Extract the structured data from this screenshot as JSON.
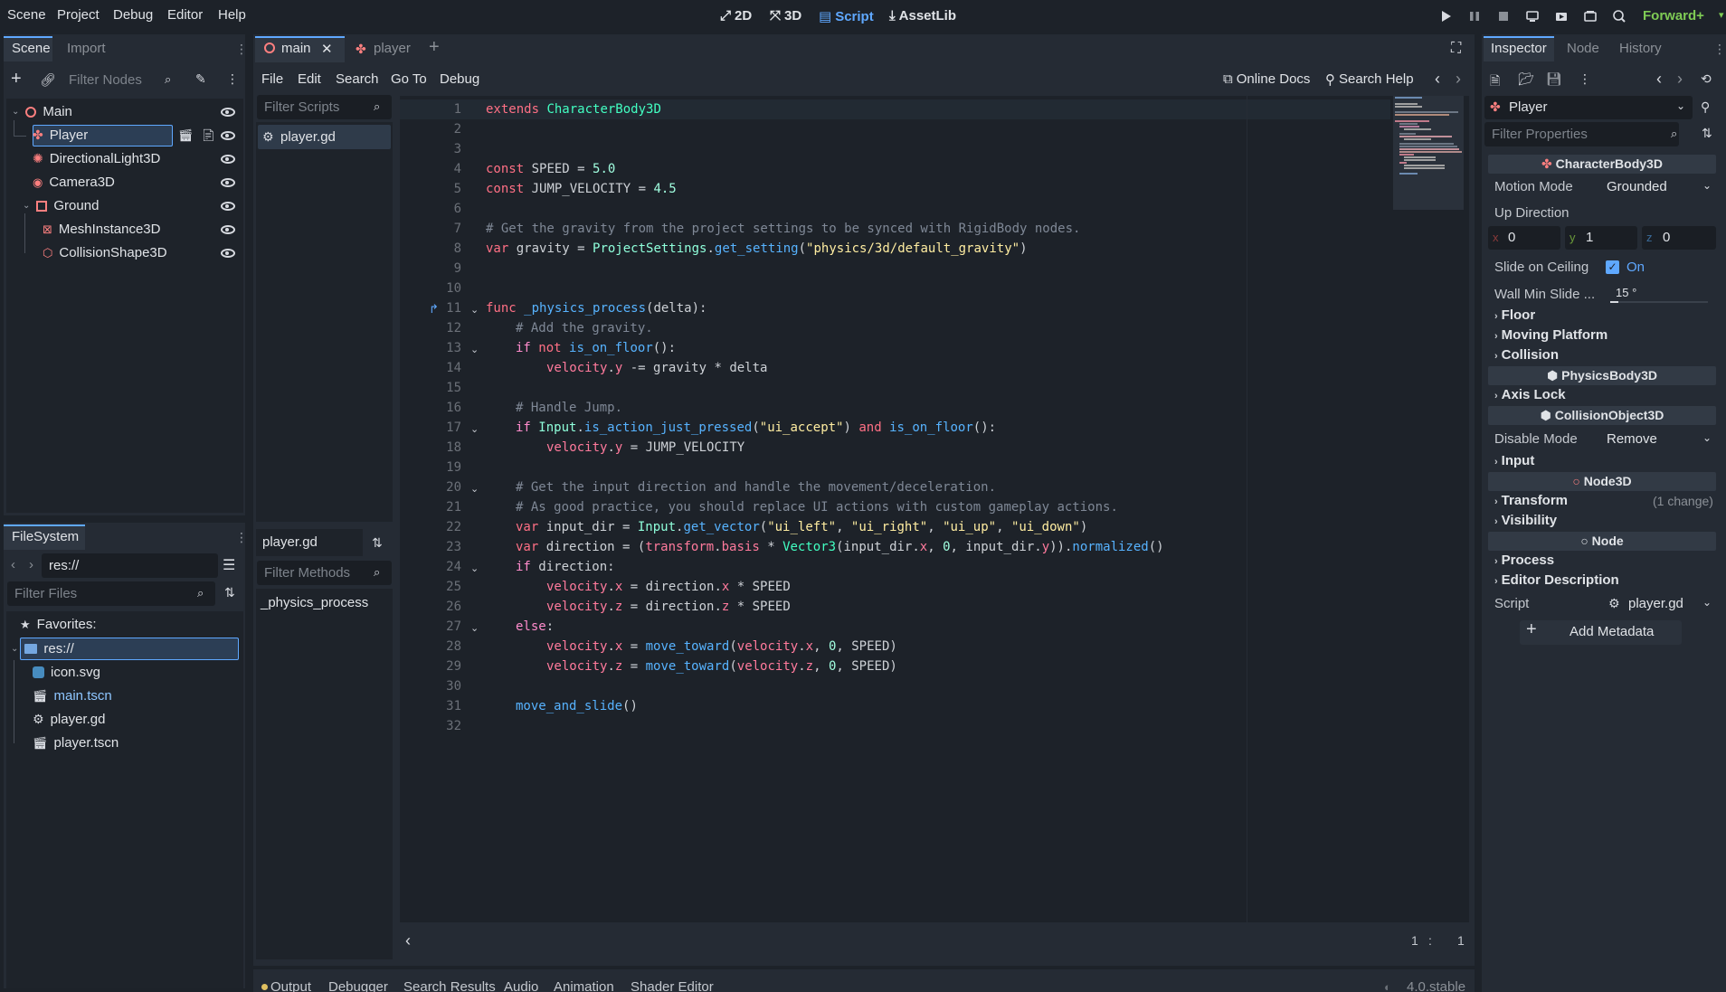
{
  "menu": [
    "Scene",
    "Project",
    "Debug",
    "Editor",
    "Help"
  ],
  "modes": [
    {
      "label": "2D",
      "icon": "2d-icon"
    },
    {
      "label": "3D",
      "icon": "3d-icon"
    },
    {
      "label": "Script",
      "icon": "script-icon"
    },
    {
      "label": "AssetLib",
      "icon": "assetlib-icon"
    }
  ],
  "renderer": "Forward+",
  "scene_dock": {
    "tabs": [
      "Scene",
      "Import"
    ],
    "filter_placeholder": "Filter Nodes",
    "nodes": [
      "Main",
      "Player",
      "DirectionalLight3D",
      "Camera3D",
      "Ground",
      "MeshInstance3D",
      "CollisionShape3D"
    ]
  },
  "filesystem": {
    "tab": "FileSystem",
    "path": "res://",
    "filter_placeholder": "Filter Files",
    "favorites": "Favorites:",
    "root": "res://",
    "files": [
      "icon.svg",
      "main.tscn",
      "player.gd",
      "player.tscn"
    ]
  },
  "editor_tabs": [
    "main",
    "player"
  ],
  "script_menu": [
    "File",
    "Edit",
    "Search",
    "Go To",
    "Debug"
  ],
  "online_docs": "Online Docs",
  "search_help": "Search Help",
  "scripts_filter": "Filter Scripts",
  "scripts": [
    "player.gd"
  ],
  "current_script": "player.gd",
  "methods_filter": "Filter Methods",
  "methods": [
    "_physics_process"
  ],
  "cursor": {
    "line": "1",
    "sep": ":",
    "col": "1"
  },
  "bottom_tabs": [
    "Output",
    "Debugger",
    "Search Results",
    "Audio",
    "Animation",
    "Shader Editor"
  ],
  "version": "4.0.stable",
  "inspector": {
    "tabs": [
      "Inspector",
      "Node",
      "History"
    ],
    "object": "Player",
    "filter_placeholder": "Filter Properties",
    "class_character": "CharacterBody3D",
    "motion_mode_label": "Motion Mode",
    "motion_mode": "Grounded",
    "up_direction_label": "Up Direction",
    "up_x": "0",
    "up_y": "1",
    "up_z": "0",
    "slide_label": "Slide on Ceiling",
    "slide_value": "On",
    "wall_min_label": "Wall Min Slide ...",
    "wall_min_value": "15 °",
    "group_floor": "Floor",
    "group_moving": "Moving Platform",
    "group_collision": "Collision",
    "class_physics": "PhysicsBody3D",
    "group_axis": "Axis Lock",
    "class_collision": "CollisionObject3D",
    "disable_label": "Disable Mode",
    "disable_value": "Remove",
    "group_input": "Input",
    "class_node3d": "Node3D",
    "group_transform": "Transform",
    "transform_change": "(1 change)",
    "group_visibility": "Visibility",
    "class_node": "Node",
    "group_process": "Process",
    "group_editor_desc": "Editor Description",
    "script_label": "Script",
    "script_value": "player.gd",
    "add_metadata": "Add Metadata"
  },
  "colors": {
    "accent": "#5fa8ff",
    "renderer": "#7fcc55",
    "node3d": "#fc7f7f",
    "background": "#1d2229"
  }
}
